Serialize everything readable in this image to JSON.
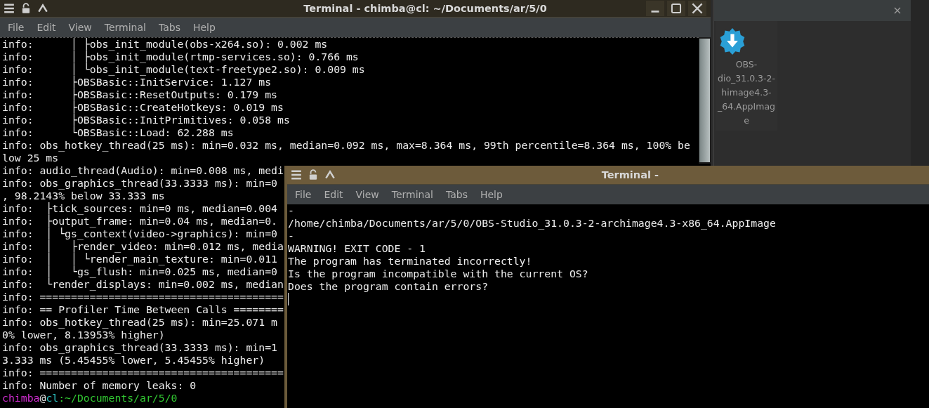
{
  "desktop": {
    "file_icon": {
      "label_lines": [
        "OBS-",
        "dio_31.0.3-2-",
        "himage4.3-",
        "_64.AppImag",
        "e"
      ]
    }
  },
  "windows": [
    {
      "title": "Terminal - chimba@cl: ~/Documents/ar/5/0",
      "menu": [
        "File",
        "Edit",
        "View",
        "Terminal",
        "Tabs",
        "Help"
      ],
      "lines": [
        "info:      │ ├obs_init_module(obs-x264.so): 0.002 ms",
        "info:      │ ├obs_init_module(rtmp-services.so): 0.766 ms",
        "info:      │ └obs_init_module(text-freetype2.so): 0.009 ms",
        "info:      ├OBSBasic::InitService: 1.127 ms",
        "info:      ├OBSBasic::ResetOutputs: 0.179 ms",
        "info:      ├OBSBasic::CreateHotkeys: 0.019 ms",
        "info:      ├OBSBasic::InitPrimitives: 0.058 ms",
        "info:      └OBSBasic::Load: 62.288 ms",
        "info: obs_hotkey_thread(25 ms): min=0.032 ms, median=0.092 ms, max=8.364 ms, 99th percentile=8.364 ms, 100% be",
        "low 25 ms",
        "info: audio_thread(Audio): min=0.008 ms, medi",
        "info: obs_graphics_thread(33.3333 ms): min=0",
        ", 98.2143% below 33.333 ms",
        "info:  ├tick_sources: min=0 ms, median=0.004",
        "info:  ├output_frame: min=0.04 ms, median=0.",
        "info:  │ └gs_context(video->graphics): min=0",
        "info:  │   ├render_video: min=0.012 ms, media",
        "info:  │   │ └render_main_texture: min=0.011",
        "info:  │   └gs_flush: min=0.025 ms, median=0",
        "info:  └render_displays: min=0.002 ms, median",
        "info: =======================================",
        "info: == Profiler Time Between Calls ========",
        "info: obs_hotkey_thread(25 ms): min=25.071 m",
        "0% lower, 8.13953% higher)",
        "info: obs_graphics_thread(33.3333 ms): min=1",
        "3.333 ms (5.45455% lower, 5.45455% higher)",
        "info: =======================================",
        "info: Number of memory leaks: 0"
      ],
      "prompt": {
        "user": "chimba",
        "at": "@",
        "host": "cl",
        "path": ":~/Documents/ar/5/0"
      }
    },
    {
      "title": "Terminal -",
      "menu": [
        "File",
        "Edit",
        "View",
        "Terminal",
        "Tabs",
        "Help"
      ],
      "lines": [
        "-",
        "/home/chimba/Documents/ar/5/0/OBS-Studio_31.0.3-2-archimage4.3-x86_64.AppImage",
        "-",
        "WARNING! EXIT CODE - 1",
        "The program has terminated incorrectly!",
        "Is the program incompatible with the current OS?",
        "Does the program contain errors?"
      ]
    }
  ]
}
